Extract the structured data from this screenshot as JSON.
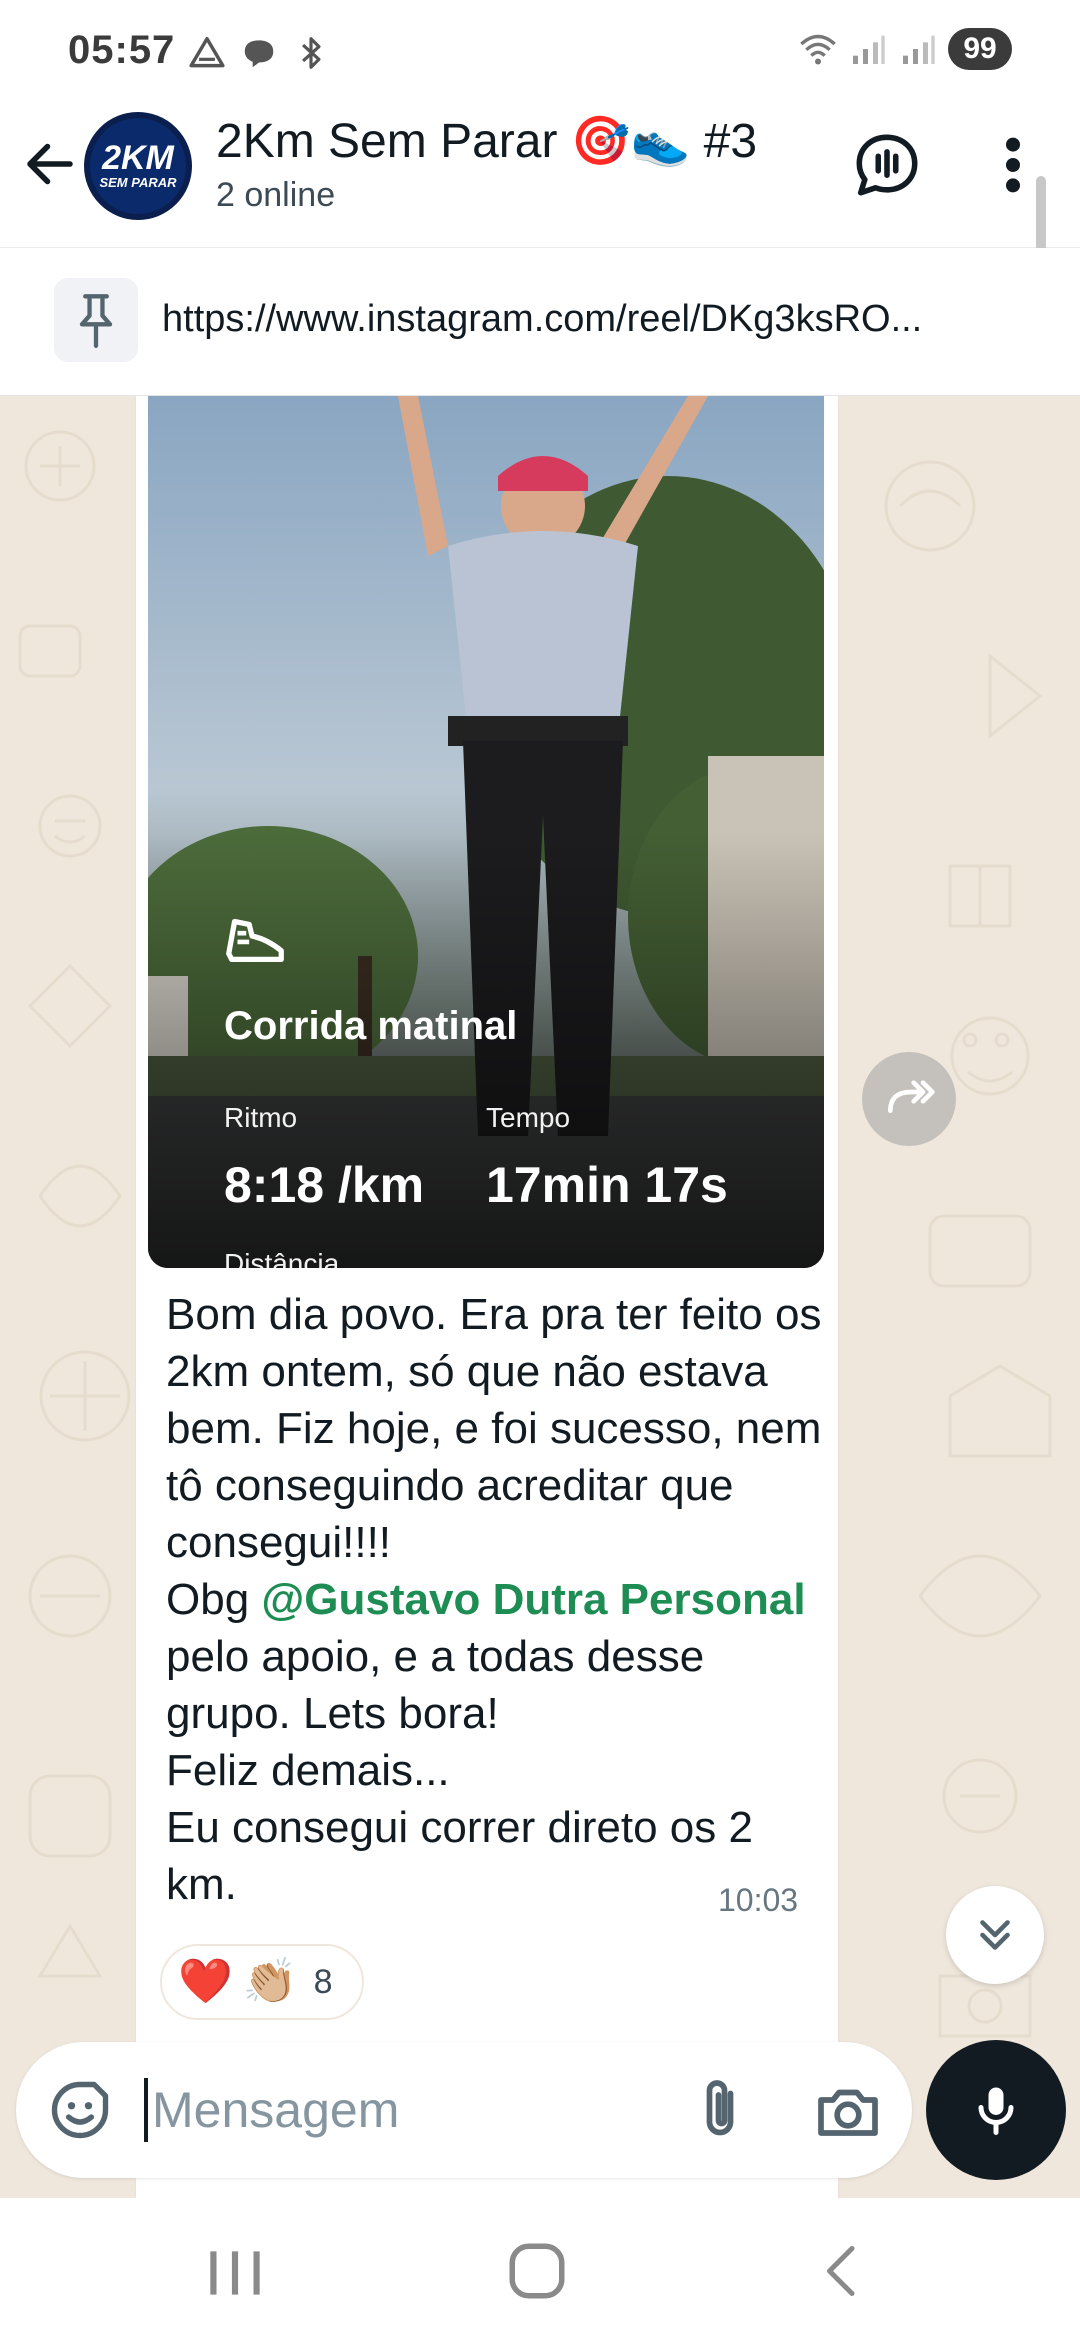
{
  "status_bar": {
    "time": "05:57",
    "battery": "99",
    "icons_left": [
      "drive-icon",
      "chat-bubble-icon",
      "bluetooth-icon"
    ],
    "icons_right": [
      "wifi-icon",
      "signal-icon",
      "signal-icon"
    ]
  },
  "header": {
    "avatar_text_big": "2KM",
    "avatar_text_small": "SEM PARAR",
    "title": "2Km Sem Parar 🎯👟 #3",
    "subtitle": "2 online"
  },
  "pinned": {
    "text": "https://www.instagram.com/reel/DKg3ksRO..."
  },
  "message": {
    "run_card": {
      "title": "Corrida matinal",
      "pace_label": "Ritmo",
      "pace_value": "8:18 /km",
      "time_label": "Tempo",
      "time_value": "17min 17s",
      "distance_label": "Distância"
    },
    "text_part1": "Bom dia povo. Era pra ter feito os 2km ontem, só que não estava bem. Fiz hoje, e foi sucesso, nem tô conseguindo acreditar que consegui!!!!\nObg ",
    "mention": "@Gustavo Dutra Personal",
    "text_part2": " pelo apoio, e a todas desse grupo. Lets bora!\nFeliz demais...\nEu consegui correr direto os 2 km.",
    "time": "10:03",
    "reactions": {
      "emoji1": "❤️",
      "emoji2": "👏🏼",
      "count": "8"
    }
  },
  "composer": {
    "placeholder": "Mensagem"
  },
  "colors": {
    "chat_background": "#efe7dc",
    "mention": "#1d8d53",
    "mic_button": "#111b21"
  }
}
